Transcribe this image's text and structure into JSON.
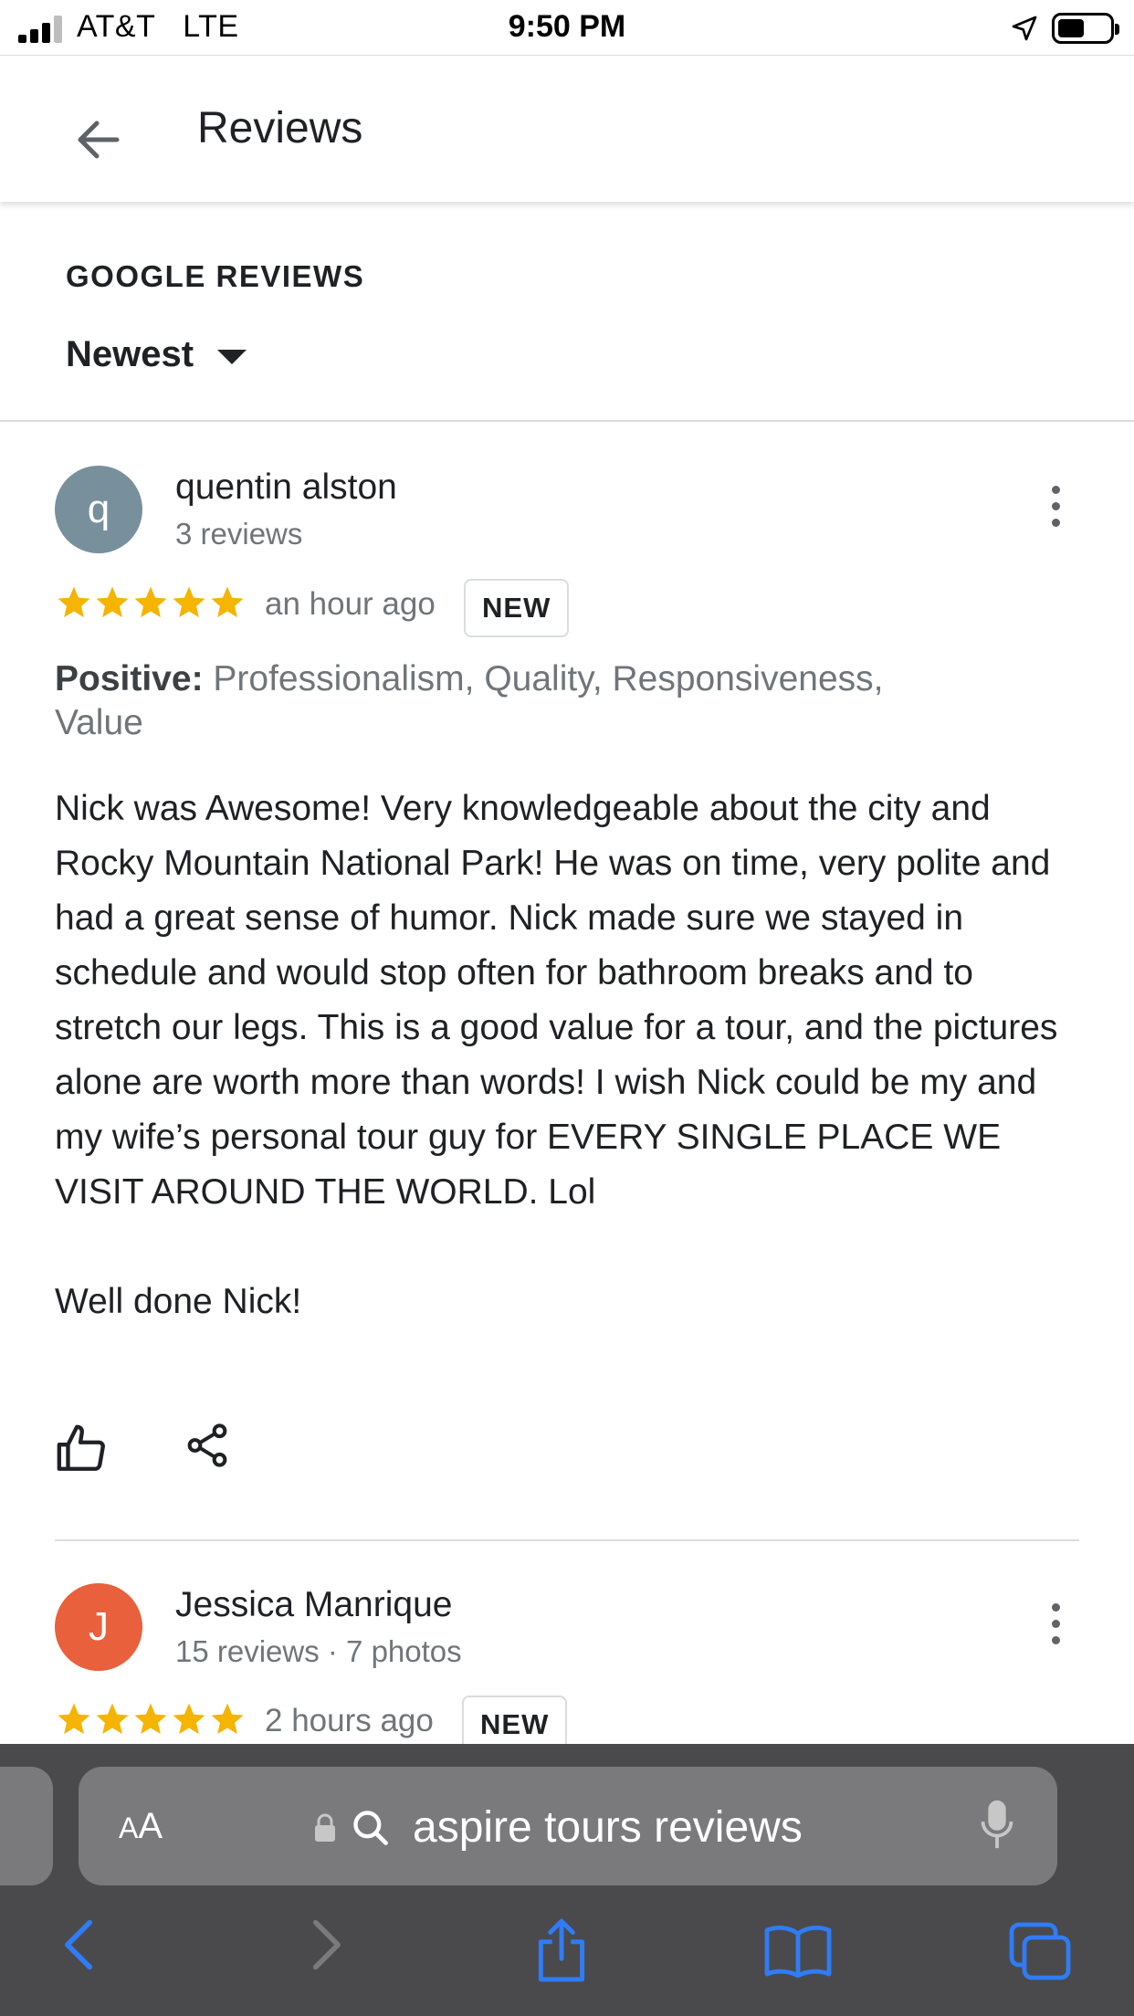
{
  "status_bar": {
    "carrier": "AT&T",
    "network": "LTE",
    "time": "9:50 PM"
  },
  "header": {
    "title": "Reviews"
  },
  "section": {
    "label": "GOOGLE REVIEWS",
    "sort": "Newest"
  },
  "colors": {
    "star": "#f4b400",
    "avatar1": "#78909c",
    "avatar2": "#e8603c",
    "safari_bar": "#4a4a4c",
    "safari_blue": "#2f7cf6"
  },
  "reviews": [
    {
      "initial": "q",
      "name": "quentin alston",
      "meta": "3 reviews",
      "rating": 5,
      "time": "an hour ago",
      "badge": "NEW",
      "positive_label": "Positive:",
      "positive_values": " Professionalism, Quality, Responsiveness,\n Value",
      "text": "Nick was Awesome! Very knowledgeable about the city and Rocky Mountain National Park! He was on time, very polite and had a great sense of humor. Nick made sure we stayed in schedule and would stop often for bathroom breaks and to stretch our legs. This is a good value for a tour, and the pictures alone are worth more than words! I wish Nick could be my and my wife’s personal tour guy for EVERY SINGLE PLACE WE VISIT AROUND THE WORLD. Lol\n\nWell done Nick!"
    },
    {
      "initial": "J",
      "name": "Jessica Manrique",
      "meta": "15 reviews · 7 photos",
      "rating": 5,
      "time": "2 hours ago",
      "badge": "NEW"
    }
  ],
  "safari": {
    "text_size": "AA",
    "address": "aspire tours reviews"
  },
  "icons": [
    "back-arrow-icon",
    "kebab-menu-icon",
    "thumbs-up-icon",
    "share-icon",
    "lock-icon",
    "search-icon",
    "microphone-icon",
    "chevron-left-icon",
    "chevron-right-icon",
    "share-upload-icon",
    "bookmarks-icon",
    "tabs-icon"
  ]
}
